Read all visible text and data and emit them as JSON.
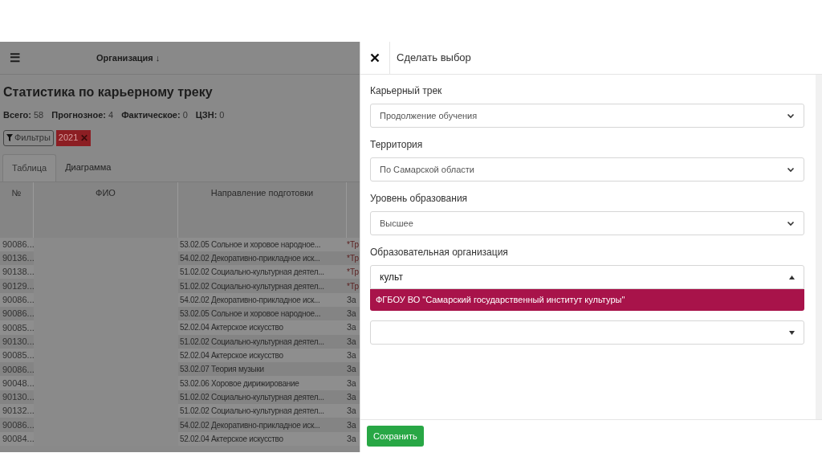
{
  "topbar": {
    "menu_icon": "☰",
    "title": "Организация ↓"
  },
  "page": {
    "title": "Статистика по карьерному треку",
    "stats": [
      {
        "label": "Всего:",
        "value": "58"
      },
      {
        "label": "Прогнозное:",
        "value": "4"
      },
      {
        "label": "Фактическое:",
        "value": "0"
      },
      {
        "label": "ЦЗН:",
        "value": "0"
      }
    ],
    "filters_button": "Фильтры",
    "filter_tags": [
      {
        "label": "2021",
        "remove": "✕"
      }
    ],
    "tabs": [
      {
        "label": "Таблица",
        "selected": true
      },
      {
        "label": "Диаграмма",
        "selected": false
      }
    ]
  },
  "table": {
    "columns": [
      "№",
      "ФИО",
      "Направление подготовки"
    ],
    "rows": [
      {
        "id": "90086...",
        "direction": "53.02.05 Сольное и хоровое народное...",
        "column_4": "*Тр",
        "flag": true
      },
      {
        "id": "90136...",
        "direction": "54.02.02 Декоративно-прикладное иск...",
        "column_4": "*Тр",
        "flag": true
      },
      {
        "id": "90138...",
        "direction": "51.02.02 Социально-культурная деятел...",
        "column_4": "*Тр",
        "flag": true
      },
      {
        "id": "90129...",
        "direction": "51.02.02 Социально-культурная деятел...",
        "column_4": "*Тр",
        "flag": true
      },
      {
        "id": "90086...",
        "direction": "54.02.02 Декоративно-прикладное иск...",
        "column_4": "За",
        "flag": false
      },
      {
        "id": "90086...",
        "direction": "53.02.05 Сольное и хоровое народное...",
        "column_4": "За",
        "flag": false
      },
      {
        "id": "90085...",
        "direction": "52.02.04 Актерское искусство",
        "column_4": "За",
        "flag": false
      },
      {
        "id": "90130...",
        "direction": "51.02.02 Социально-культурная деятел...",
        "column_4": "За",
        "flag": false
      },
      {
        "id": "90085...",
        "direction": "52.02.04 Актерское искусство",
        "column_4": "За",
        "flag": false
      },
      {
        "id": "90086...",
        "direction": "53.02.07 Теория музыки",
        "column_4": "За",
        "flag": false
      },
      {
        "id": "90048...",
        "direction": "53.02.06 Хоровое дирижирование",
        "column_4": "За",
        "flag": false
      },
      {
        "id": "90130...",
        "direction": "51.02.02 Социально-культурная деятел...",
        "column_4": "За",
        "flag": false
      },
      {
        "id": "90132...",
        "direction": "51.02.02 Социально-культурная деятел...",
        "column_4": "За",
        "flag": false
      },
      {
        "id": "90086...",
        "direction": "54.02.02 Декоративно-прикладное иск...",
        "column_4": "За",
        "flag": false
      },
      {
        "id": "90084...",
        "direction": "52.02.04 Актерское искусство",
        "column_4": "За",
        "flag": false
      }
    ]
  },
  "panel": {
    "title": "Сделать выбор",
    "fields": [
      {
        "kind": "select",
        "label": "Карьерный трек",
        "value": "Продолжение обучения"
      },
      {
        "kind": "select",
        "label": "Территория",
        "value": "По Самарской области"
      },
      {
        "kind": "select",
        "label": "Уровень образования",
        "value": "Высшее"
      },
      {
        "kind": "combobox",
        "label": "Образовательная организация",
        "value": "культ",
        "expanded": true,
        "options": [
          {
            "label": "ФГБОУ ВО \"Самарский государственный институт культуры\"",
            "selected": true
          }
        ]
      },
      {
        "kind": "combobox",
        "expanded": false
      }
    ],
    "save_button": "Сохранить"
  }
}
